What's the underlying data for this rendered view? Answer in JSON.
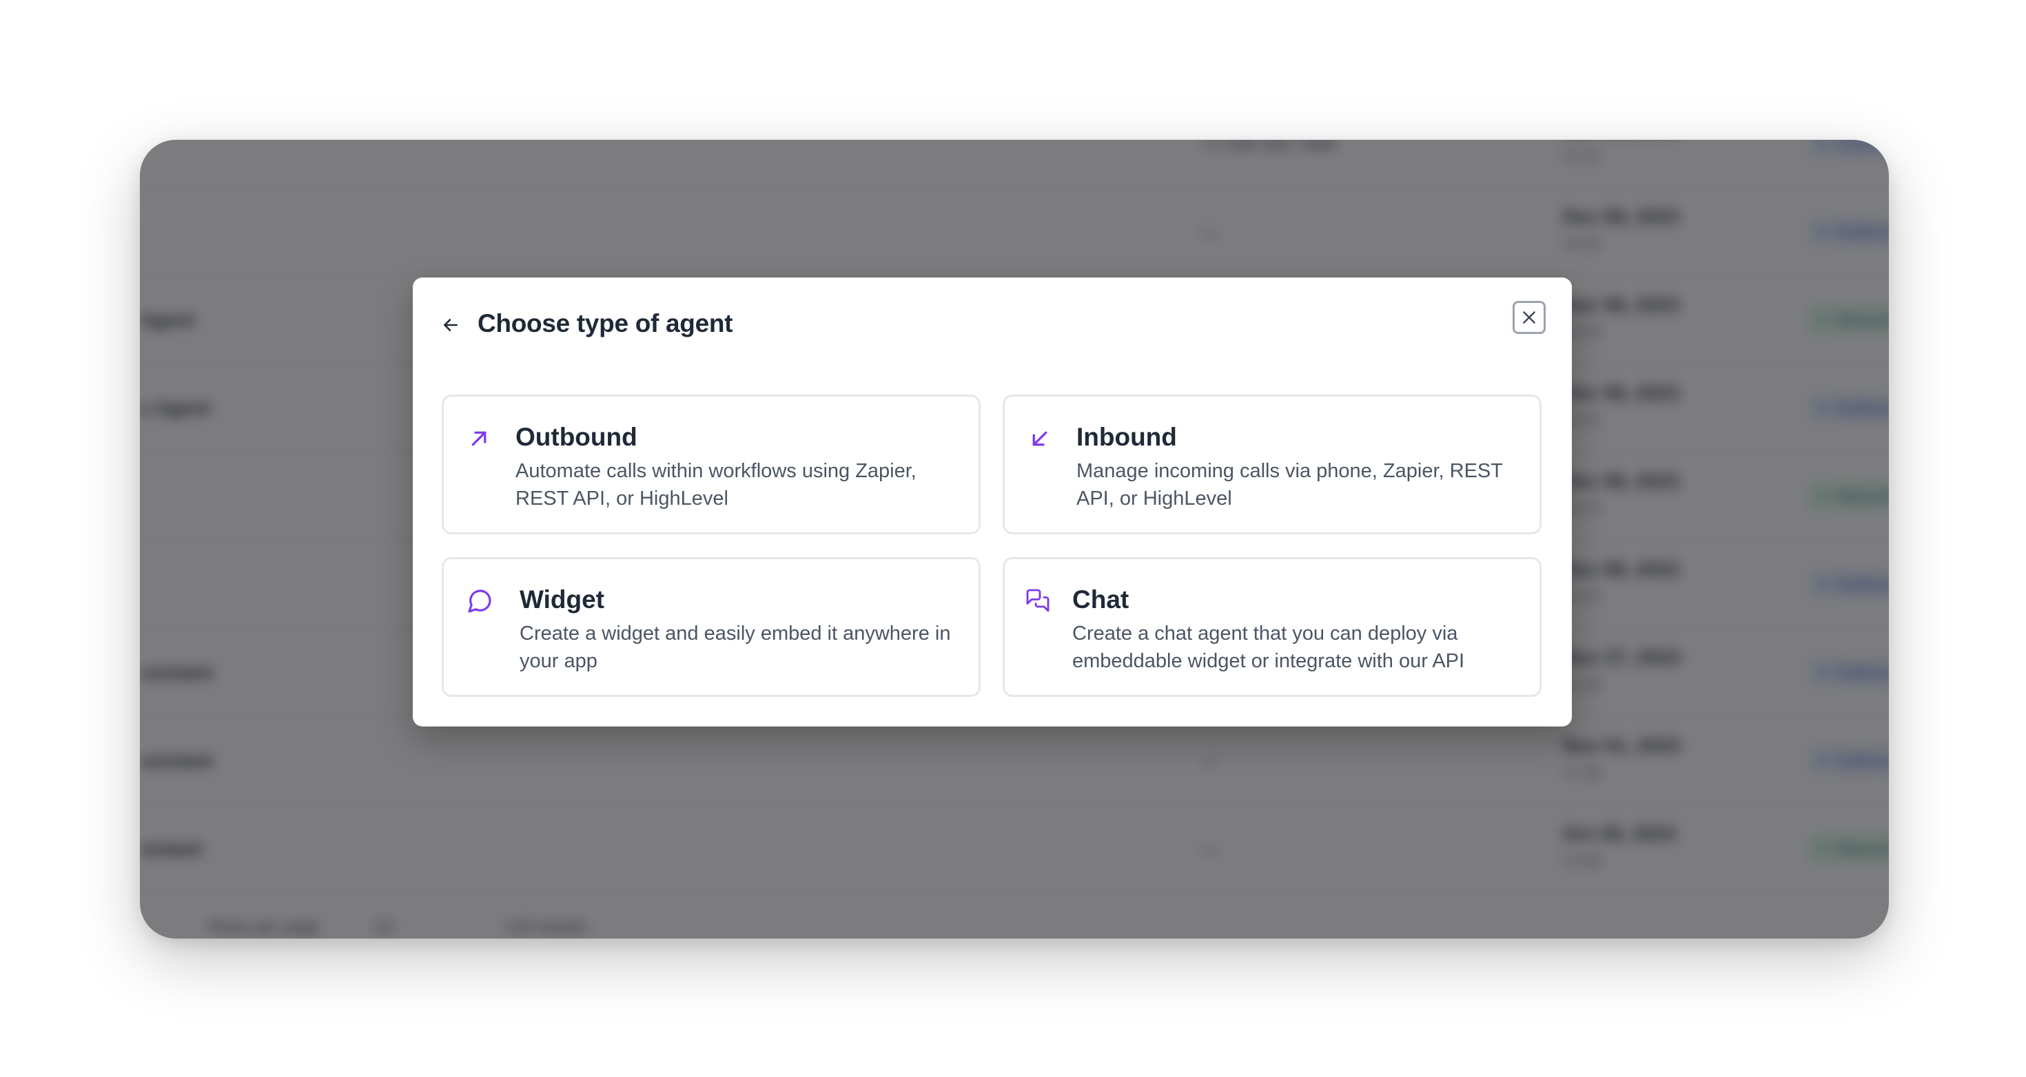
{
  "modal": {
    "title": "Choose type of agent",
    "options": [
      {
        "title": "Outbound",
        "description": "Automate calls within workflows using Zapier, REST API, or HighLevel",
        "icon": "arrow-up-right-icon"
      },
      {
        "title": "Inbound",
        "description": "Manage incoming calls via phone, Zapier, REST API, or HighLevel",
        "icon": "arrow-down-left-icon"
      },
      {
        "title": "Widget",
        "description": "Create a widget and easily embed it anywhere in your app",
        "icon": "message-circle-icon"
      },
      {
        "title": "Chat",
        "description": "Create a chat agent that you can deploy via embeddable widget or integrate with our API",
        "icon": "messages-icon"
      }
    ]
  },
  "colors": {
    "accent": "#7c3aed",
    "overlay": "#1e1e20"
  }
}
